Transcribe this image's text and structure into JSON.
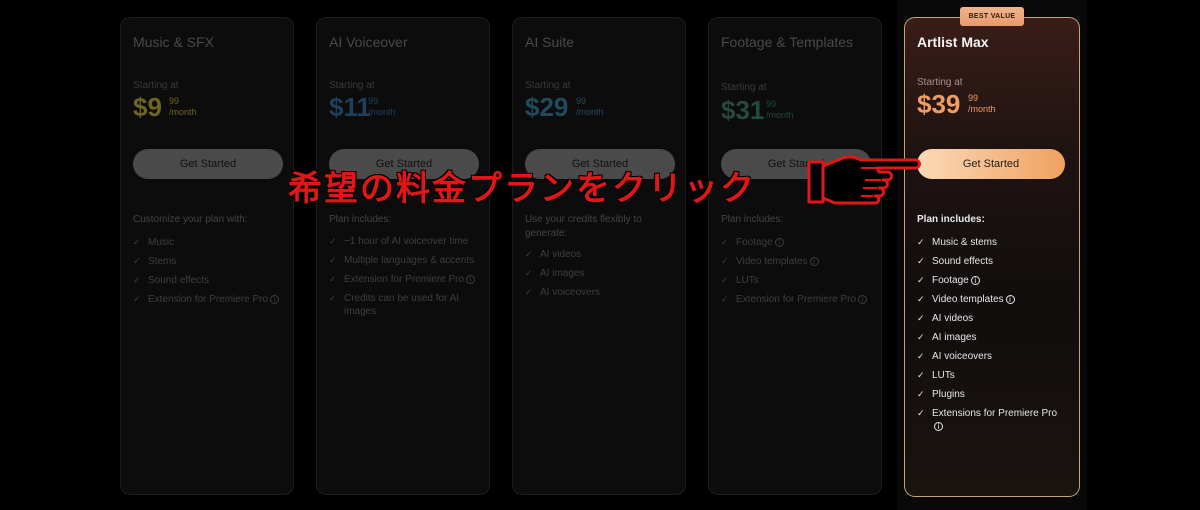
{
  "plans": [
    {
      "title": "Music & SFX",
      "starting": "Starting at",
      "price": "$9",
      "cents": "99",
      "period": "/month",
      "price_color": "#6e6520",
      "cta": "Get Started",
      "includes": "Customize your plan with:",
      "features": [
        "Music",
        "Stems",
        "Sound effects",
        "Extension for Premiere Pro"
      ]
    },
    {
      "title": "AI Voiceover",
      "starting": "Starting at",
      "price": "$11",
      "cents": "99",
      "period": "/month",
      "price_color": "#1f3f5e",
      "cta": "Get Started",
      "includes": "Plan includes:",
      "features": [
        "~1 hour of AI voiceover time",
        "Multiple languages & accents",
        "Extension for Premiere Pro",
        "Credits can be used for AI images"
      ]
    },
    {
      "title": "AI Suite",
      "starting": "Starting at",
      "price": "$29",
      "cents": "99",
      "period": "/month",
      "price_color": "#234a5c",
      "cta": "Get Started",
      "includes": "Use your credits flexibly to generate:",
      "features": [
        "AI videos",
        "AI images",
        "AI voiceovers"
      ]
    },
    {
      "title": "Footage & Templates",
      "starting": "Starting at",
      "price": "$31",
      "cents": "99",
      "period": "/month",
      "price_color": "#234a3a",
      "cta": "Get Started",
      "includes": "Plan includes:",
      "features": [
        "Footage",
        "Video templates",
        "LUTs",
        "Extension for Premiere Pro"
      ]
    }
  ],
  "max": {
    "badge": "BEST VALUE",
    "title": "Artlist Max",
    "starting": "Starting at",
    "price": "$39",
    "cents": "99",
    "period": "/month",
    "cta": "Get Started",
    "includes": "Plan includes:",
    "features": [
      "Music & stems",
      "Sound effects",
      "Footage",
      "Video templates",
      "AI videos",
      "AI images",
      "AI voiceovers",
      "LUTs",
      "Plugins",
      "Extensions for Premiere Pro"
    ]
  },
  "overlay": "希望の料金プランをクリック",
  "accent_color": "#e11717"
}
